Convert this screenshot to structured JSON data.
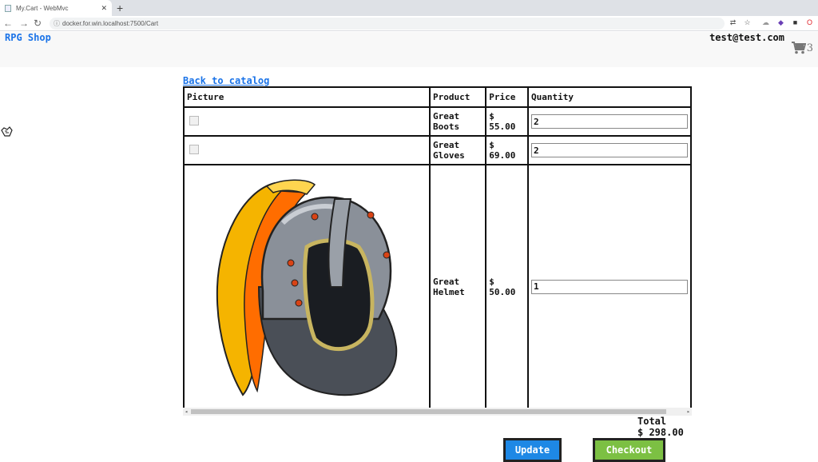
{
  "browser": {
    "tab_title": "My.Cart - WebMvc",
    "url": "docker.for.win.localhost:7500/Cart"
  },
  "header": {
    "brand": "RPG Shop",
    "user_email": "test@test.com",
    "cart_count": "3"
  },
  "back_link": "Back to catalog",
  "table": {
    "headers": [
      "Picture",
      "Product",
      "Price",
      "Quantity"
    ],
    "rows": [
      {
        "product": "Great Boots",
        "price": "$ 55.00",
        "quantity": "2"
      },
      {
        "product": "Great Gloves",
        "price": "$ 69.00",
        "quantity": "2"
      },
      {
        "product": "Great Helmet",
        "price": "$ 50.00",
        "quantity": "1"
      }
    ]
  },
  "total": {
    "label": "Total",
    "value": "$ 298.00"
  },
  "buttons": {
    "update": "Update",
    "checkout": "Checkout"
  },
  "colors": {
    "link": "#1a73e8",
    "update_button": "#1e88e5",
    "checkout_button": "#7cc043"
  }
}
